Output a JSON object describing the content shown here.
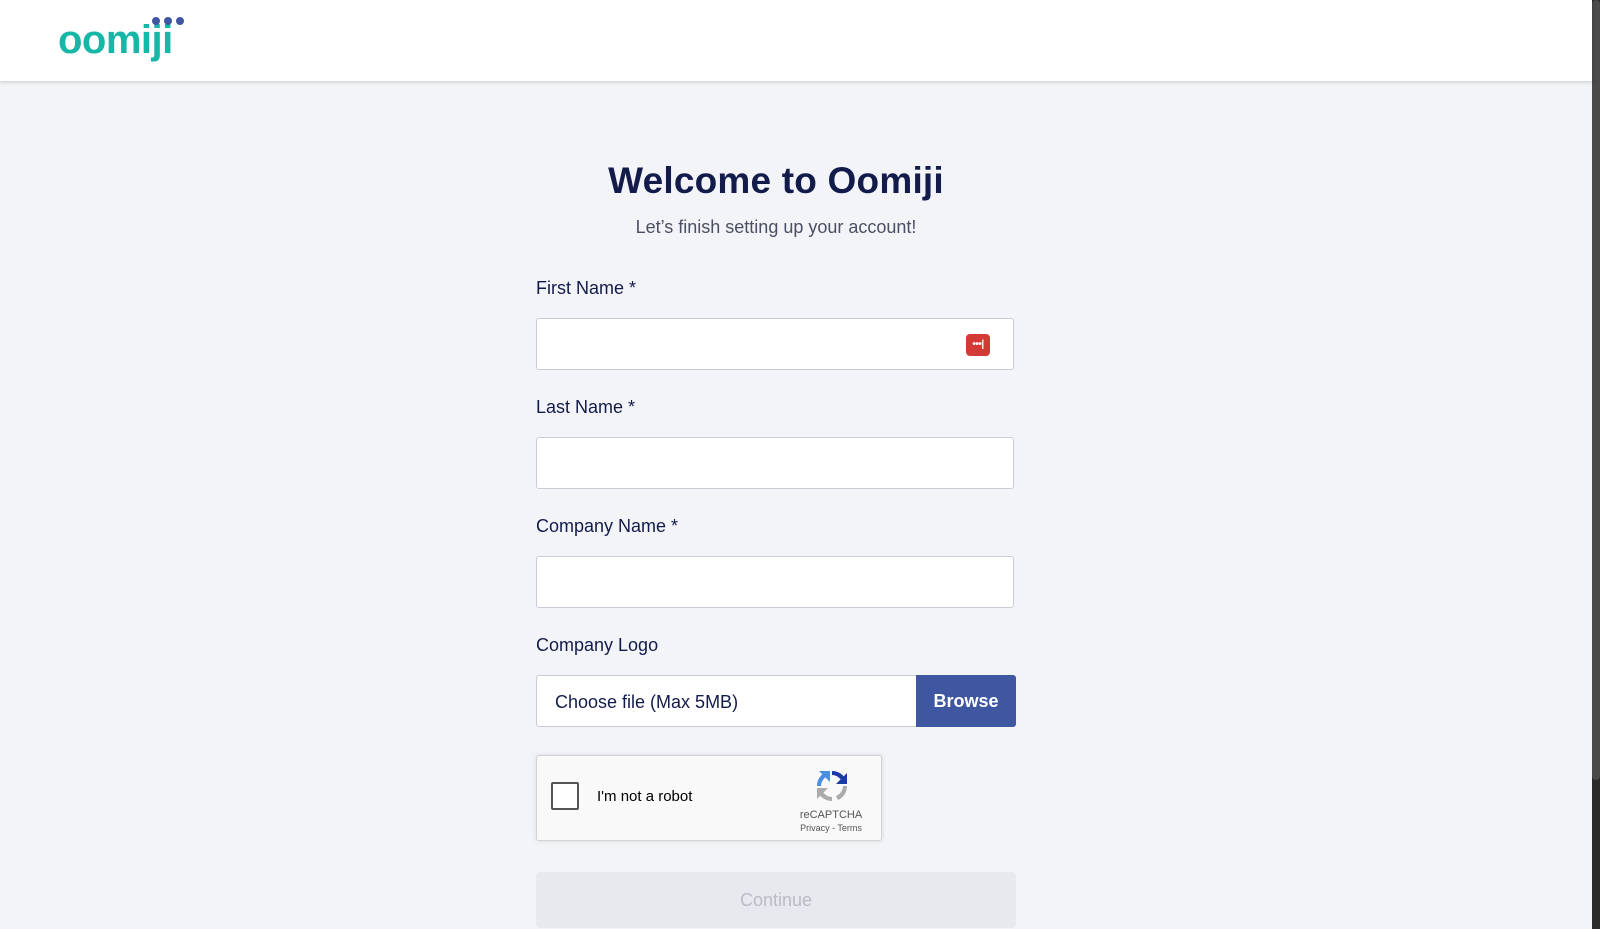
{
  "brand": {
    "logo_text": "oomiji",
    "logo_color": "#17b7a8",
    "dots_color": "#3f56a1"
  },
  "main": {
    "title": "Welcome to Oomiji",
    "subtitle": "Let’s finish setting up your account!"
  },
  "form": {
    "first_name_label": "First Name *",
    "first_name_value": "",
    "last_name_label": "Last Name *",
    "last_name_value": "",
    "company_name_label": "Company Name *",
    "company_name_value": "",
    "company_logo_label": "Company Logo",
    "file_placeholder": "Choose file (Max 5MB)",
    "browse_label": "Browse",
    "password_manager_icon": "lastpass-icon",
    "continue_label": "Continue"
  },
  "recaptcha": {
    "label": "I'm not a robot",
    "checked": false,
    "brand": "reCAPTCHA",
    "terms": "Privacy - Terms",
    "icon": "recaptcha-icon"
  },
  "colors": {
    "accent": "#3f56a1",
    "heading": "#131b4b",
    "page_bg": "#f3f4f8"
  }
}
